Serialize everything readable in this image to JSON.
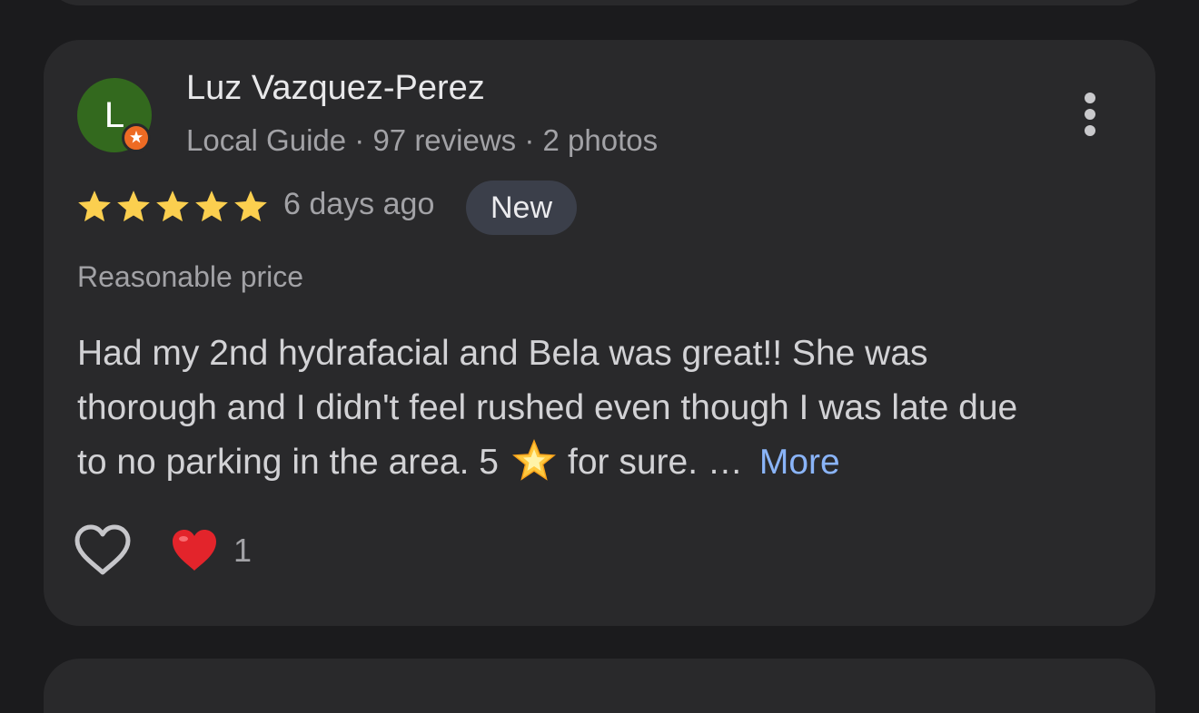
{
  "review": {
    "reviewer": {
      "initial": "L",
      "name": "Luz Vazquez-Perez",
      "meta": "Local Guide · 97 reviews · 2 photos",
      "avatar_color": "#33691e",
      "badge_color": "#ee6b24"
    },
    "rating": 5,
    "rating_max": 5,
    "date": "6 days ago",
    "badge": "New",
    "price_note": "Reasonable price",
    "text": {
      "line1": "Had my 2nd hydrafacial and Bela was great!! She was",
      "line2": "thorough and I didn't feel rushed even though I was late due",
      "line3_start": "to no parking in the area. 5",
      "line3_end": "for sure. …",
      "emoji_icon": "glowing-star-icon"
    },
    "more_label": "More",
    "reactions": {
      "like_icon": "heart-outline-icon",
      "reaction_icon": "red-heart-icon",
      "count": "1"
    },
    "colors": {
      "star": "#fbcf4f",
      "link": "#8ab4f8",
      "heart": "#e3242b"
    }
  }
}
